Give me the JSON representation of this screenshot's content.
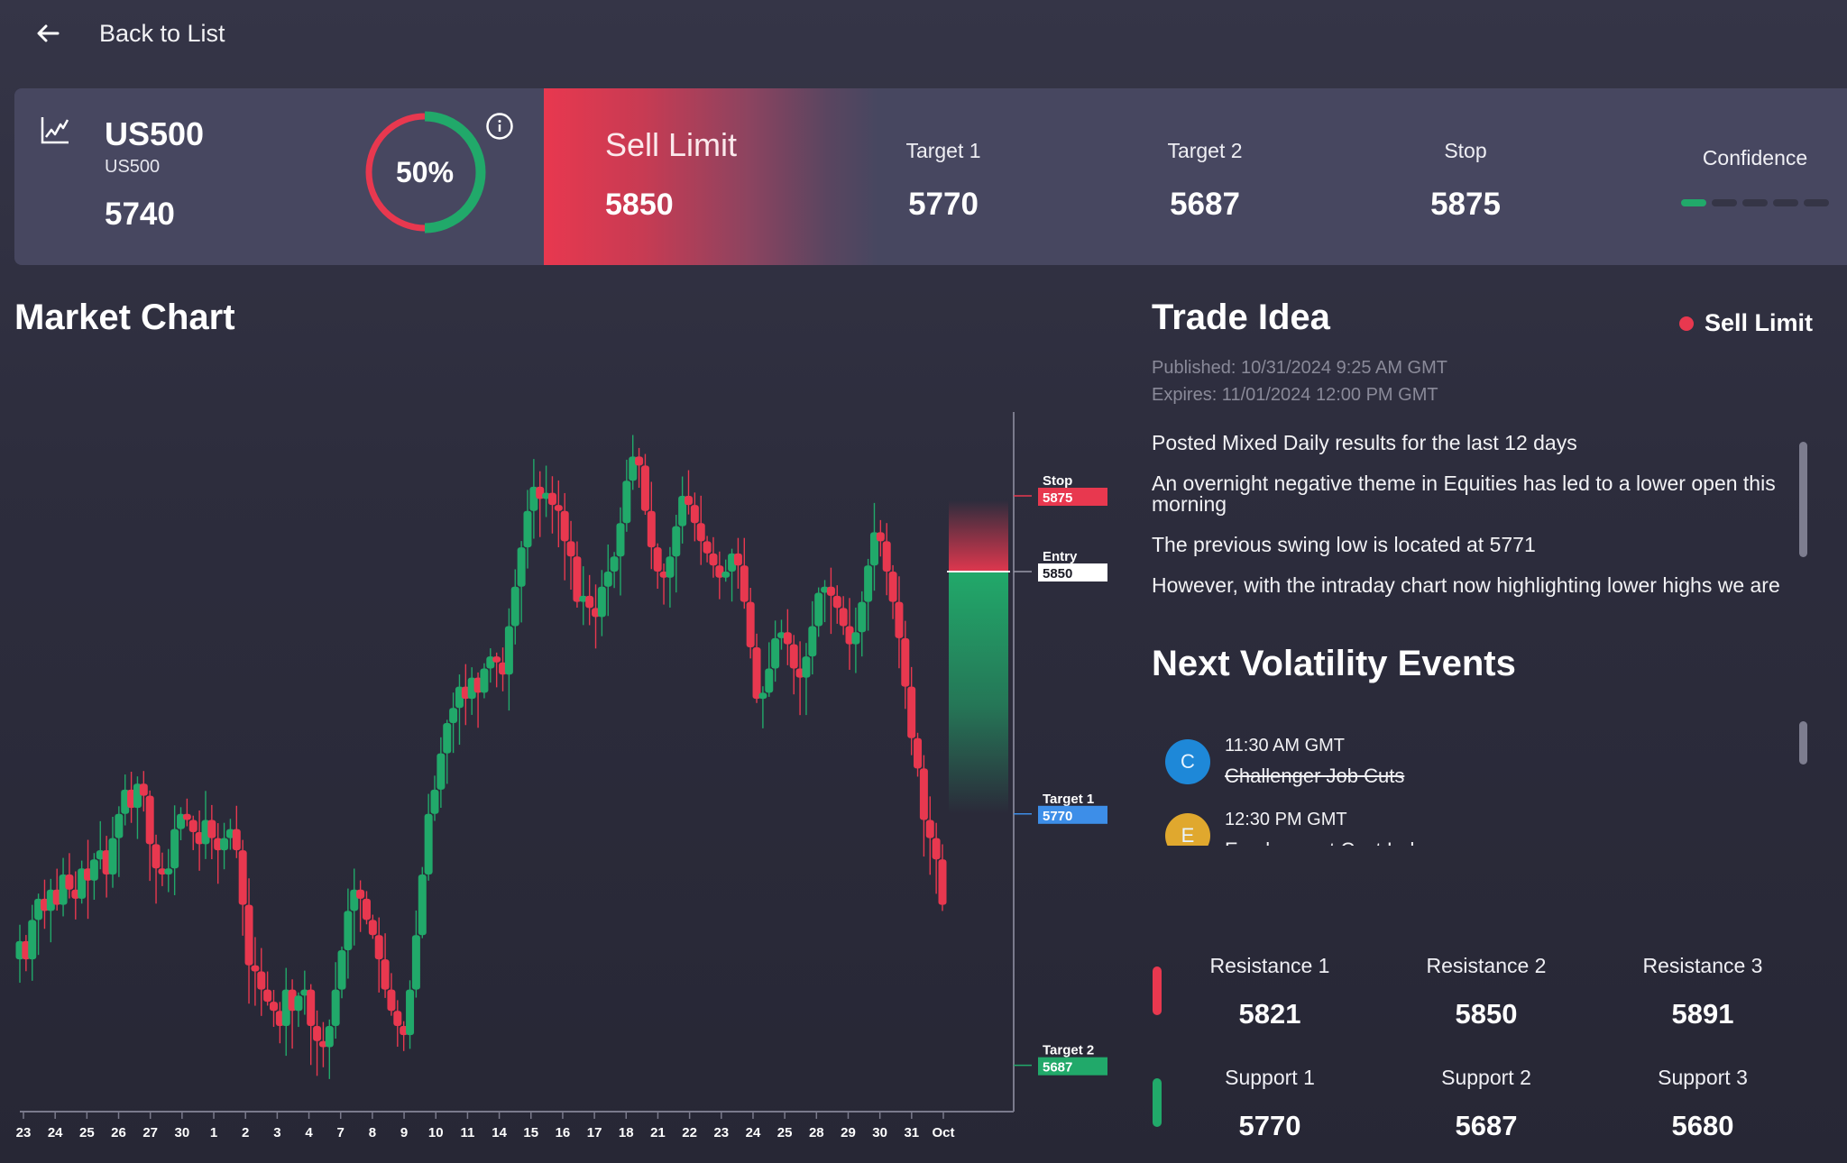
{
  "nav": {
    "back_label": "Back to List",
    "back_icon": "arrow-left-icon"
  },
  "summary": {
    "symbol": "US500",
    "symbol_sub": "US500",
    "price": "5740",
    "confidence_gauge": {
      "label": "50%",
      "value": 0.5,
      "colors": {
        "bear": "#e8384f",
        "bull": "#21a96a"
      }
    },
    "order": {
      "type": "Sell Limit",
      "entry": "5850"
    },
    "metrics": [
      {
        "label": "Target 1",
        "value": "5770"
      },
      {
        "label": "Target 2",
        "value": "5687"
      },
      {
        "label": "Stop",
        "value": "5875"
      }
    ],
    "confidence": {
      "label": "Confidence",
      "level": 1,
      "max": 5
    }
  },
  "market_chart": {
    "title": "Market Chart"
  },
  "chart_data": {
    "type": "candlestick",
    "title": "Market Chart",
    "x_tick_labels": [
      "23",
      "24",
      "25",
      "26",
      "27",
      "30",
      "1",
      "2",
      "3",
      "4",
      "7",
      "8",
      "9",
      "10",
      "11",
      "14",
      "15",
      "16",
      "17",
      "18",
      "21",
      "22",
      "23",
      "24",
      "25",
      "28",
      "29",
      "30",
      "31",
      "Oct"
    ],
    "y_range": [
      5660,
      5905
    ],
    "closes": [
      5728,
      5722,
      5735,
      5742,
      5738,
      5745,
      5740,
      5750,
      5745,
      5742,
      5752,
      5748,
      5755,
      5758,
      5750,
      5762,
      5770,
      5778,
      5772,
      5780,
      5776,
      5760,
      5752,
      5750,
      5752,
      5765,
      5770,
      5768,
      5764,
      5760,
      5768,
      5762,
      5758,
      5762,
      5765,
      5758,
      5740,
      5720,
      5718,
      5712,
      5708,
      5705,
      5700,
      5712,
      5705,
      5710,
      5712,
      5700,
      5695,
      5693,
      5700,
      5712,
      5725,
      5738,
      5745,
      5742,
      5735,
      5730,
      5722,
      5712,
      5705,
      5700,
      5697,
      5712,
      5730,
      5750,
      5770,
      5778,
      5790,
      5800,
      5805,
      5812,
      5808,
      5815,
      5810,
      5818,
      5822,
      5820,
      5816,
      5832,
      5845,
      5858,
      5870,
      5878,
      5874,
      5876,
      5872,
      5870,
      5860,
      5855,
      5840,
      5842,
      5838,
      5835,
      5845,
      5850,
      5855,
      5866,
      5880,
      5888,
      5885,
      5870,
      5858,
      5850,
      5848,
      5855,
      5865,
      5875,
      5872,
      5866,
      5860,
      5856,
      5852,
      5848,
      5850,
      5856,
      5852,
      5840,
      5825,
      5808,
      5810,
      5818,
      5828,
      5830,
      5826,
      5818,
      5815,
      5822,
      5832,
      5843,
      5845,
      5842,
      5838,
      5832,
      5826,
      5830,
      5840,
      5852,
      5863,
      5860,
      5850,
      5840,
      5828,
      5812,
      5795,
      5785,
      5768,
      5762,
      5755,
      5740
    ],
    "levels": [
      {
        "name": "Stop",
        "value": 5875,
        "color": "#e8384f"
      },
      {
        "name": "Entry",
        "value": 5850,
        "color": "#ffffff"
      },
      {
        "name": "Target 1",
        "value": 5770,
        "color": "#3d8ee8"
      },
      {
        "name": "Target 2",
        "value": 5687,
        "color": "#21a96a"
      }
    ],
    "colors": {
      "up": "#21a96a",
      "down": "#e8384f",
      "axis": "#7a7a8c"
    }
  },
  "trade_idea": {
    "title": "Trade Idea",
    "badge": "Sell Limit",
    "published": "Published: 10/31/2024 9:25 AM GMT",
    "expires": "Expires: 11/01/2024 12:00 PM GMT",
    "paragraphs": [
      "Posted Mixed Daily results for the last 12 days",
      "An overnight negative theme in Equities has led to a lower open this morning",
      "The previous swing low is located at 5771",
      "However, with the intraday chart now highlighting lower highs we are"
    ]
  },
  "volatility": {
    "title": "Next Volatility Events",
    "events": [
      {
        "initial": "C",
        "time": "11:30 AM GMT",
        "name": "Challenger Job Cuts",
        "struck": true,
        "color": "#1e88d8"
      },
      {
        "initial": "E",
        "time": "12:30 PM GMT",
        "name": "Employment Cost Index",
        "struck": false,
        "color": "#e0a82e"
      }
    ]
  },
  "levels": {
    "resistance": [
      {
        "label": "Resistance 1",
        "value": "5821"
      },
      {
        "label": "Resistance 2",
        "value": "5850"
      },
      {
        "label": "Resistance 3",
        "value": "5891"
      }
    ],
    "support": [
      {
        "label": "Support 1",
        "value": "5770"
      },
      {
        "label": "Support 2",
        "value": "5687"
      },
      {
        "label": "Support 3",
        "value": "5680"
      }
    ]
  }
}
